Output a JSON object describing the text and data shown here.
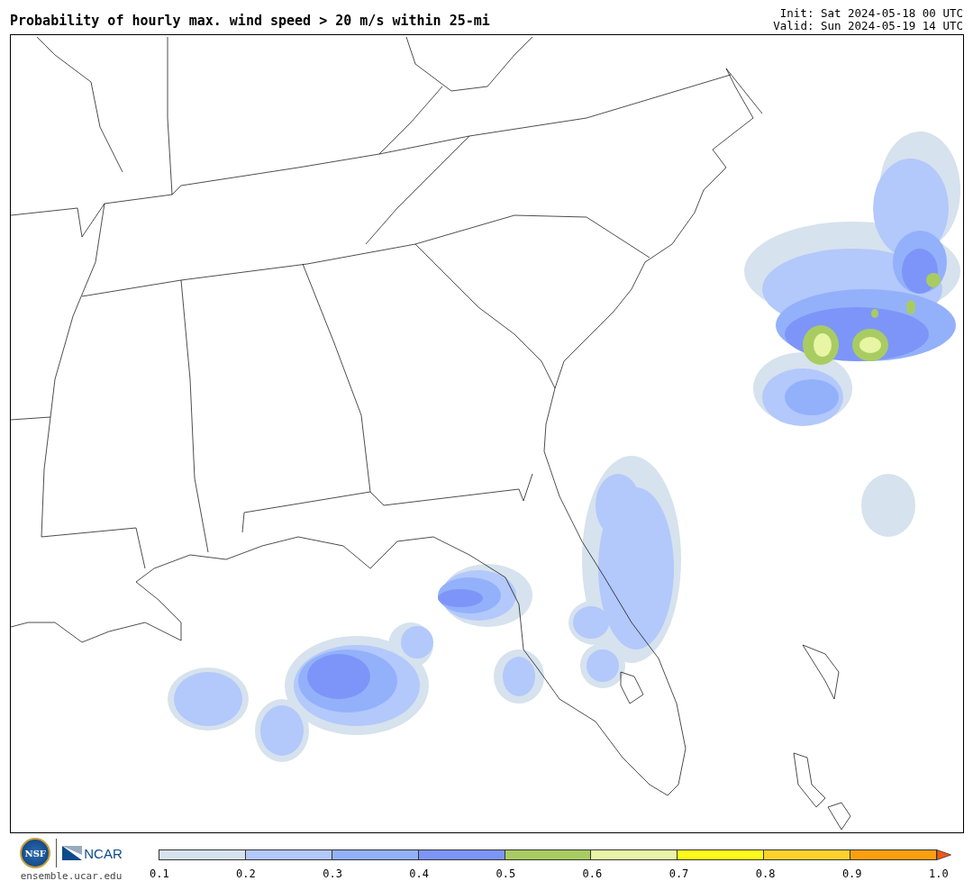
{
  "header": {
    "title": "Probability of hourly max. wind speed > 20 m/s within 25-mi",
    "init": "Init: Sat 2024-05-18 00 UTC",
    "valid": "Valid: Sun 2024-05-19 14 UTC"
  },
  "footer": {
    "logos": [
      "NSF",
      "NCAR"
    ],
    "url": "ensemble.ucar.edu"
  },
  "colorbar": {
    "bins": [
      {
        "kind": "box",
        "color": "#d6e2ed"
      },
      {
        "kind": "box",
        "color": "#b3c8fb"
      },
      {
        "kind": "box",
        "color": "#93b1fa"
      },
      {
        "kind": "box",
        "color": "#7d95f8"
      },
      {
        "kind": "box",
        "color": "#a8cc62"
      },
      {
        "kind": "box",
        "color": "#e8f5a4"
      },
      {
        "kind": "box",
        "color": "#fdfa1c"
      },
      {
        "kind": "box",
        "color": "#fdd12c"
      },
      {
        "kind": "box",
        "color": "#fb9f0f"
      },
      {
        "kind": "arrow",
        "color": "#f05a11"
      }
    ],
    "ticks": [
      "0.1",
      "0.2",
      "0.3",
      "0.4",
      "0.5",
      "0.6",
      "0.7",
      "0.8",
      "0.9",
      "1.0"
    ]
  }
}
